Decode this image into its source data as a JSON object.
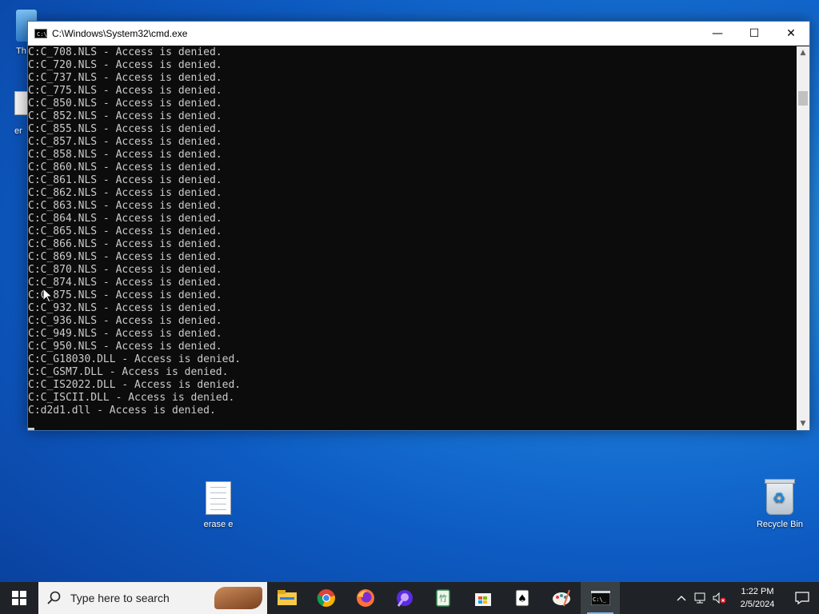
{
  "desktop": {
    "icons": [
      {
        "label": "erase e"
      },
      {
        "label": "Recycle Bin"
      }
    ],
    "partial_labels": [
      "Th",
      "er"
    ]
  },
  "window": {
    "title": "C:\\Windows\\System32\\cmd.exe",
    "minimize": "—",
    "maximize": "☐",
    "close": "✕",
    "console_lines": [
      "C:C_708.NLS - Access is denied.",
      "C:C_720.NLS - Access is denied.",
      "C:C_737.NLS - Access is denied.",
      "C:C_775.NLS - Access is denied.",
      "C:C_850.NLS - Access is denied.",
      "C:C_852.NLS - Access is denied.",
      "C:C_855.NLS - Access is denied.",
      "C:C_857.NLS - Access is denied.",
      "C:C_858.NLS - Access is denied.",
      "C:C_860.NLS - Access is denied.",
      "C:C_861.NLS - Access is denied.",
      "C:C_862.NLS - Access is denied.",
      "C:C_863.NLS - Access is denied.",
      "C:C_864.NLS - Access is denied.",
      "C:C_865.NLS - Access is denied.",
      "C:C_866.NLS - Access is denied.",
      "C:C_869.NLS - Access is denied.",
      "C:C_870.NLS - Access is denied.",
      "C:C_874.NLS - Access is denied.",
      "C:C_875.NLS - Access is denied.",
      "C:C_932.NLS - Access is denied.",
      "C:C_936.NLS - Access is denied.",
      "C:C_949.NLS - Access is denied.",
      "C:C_950.NLS - Access is denied.",
      "C:C_G18030.DLL - Access is denied.",
      "C:C_GSM7.DLL - Access is denied.",
      "C:C_IS2022.DLL - Access is denied.",
      "C:C_ISCII.DLL - Access is denied.",
      "C:d2d1.dll - Access is denied."
    ]
  },
  "taskbar": {
    "search_placeholder": "Type here to search",
    "apps": [
      {
        "name": "file-explorer-icon",
        "active": false
      },
      {
        "name": "chrome-icon",
        "active": false
      },
      {
        "name": "firefox-icon",
        "active": false
      },
      {
        "name": "purple-app-icon",
        "active": false
      },
      {
        "name": "mahjong-icon",
        "active": false
      },
      {
        "name": "store-icon",
        "active": false
      },
      {
        "name": "solitaire-icon",
        "active": false
      },
      {
        "name": "paint-icon",
        "active": false
      },
      {
        "name": "cmd-icon",
        "active": true
      }
    ],
    "time": "1:22 PM",
    "date": "2/5/2024"
  },
  "colors": {
    "console_bg": "#0c0c0c",
    "console_text": "#cccccc",
    "taskbar_bg": "#1f2327"
  }
}
